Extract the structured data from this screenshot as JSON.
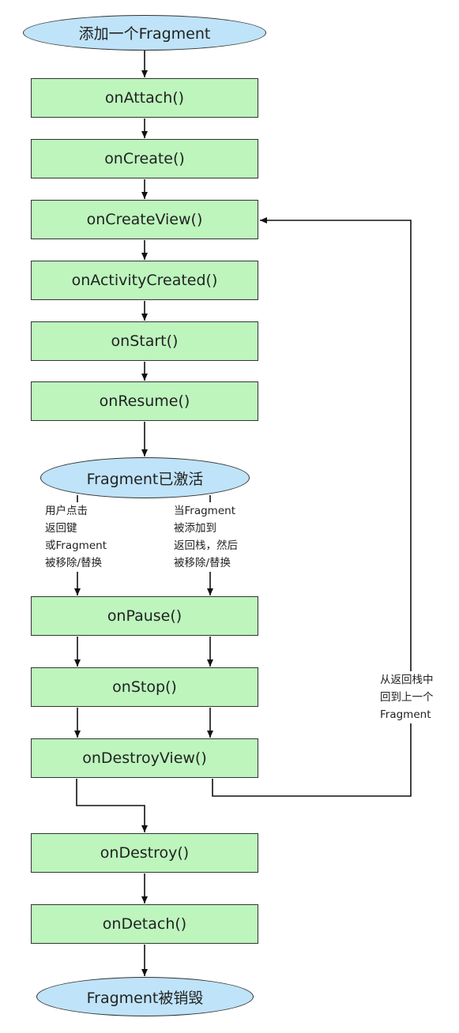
{
  "start": {
    "label": "添加一个Fragment"
  },
  "steps": [
    {
      "id": "on-attach",
      "label": "onAttach()"
    },
    {
      "id": "on-create",
      "label": "onCreate()"
    },
    {
      "id": "on-create-view",
      "label": "onCreateView()"
    },
    {
      "id": "on-activity-created",
      "label": "onActivityCreated()"
    },
    {
      "id": "on-start",
      "label": "onStart()"
    },
    {
      "id": "on-resume",
      "label": "onResume()"
    }
  ],
  "active": {
    "label": "Fragment已激活"
  },
  "branch_left": {
    "lines": [
      "用户点击",
      "返回键",
      "或Fragment",
      "被移除/替换"
    ]
  },
  "branch_right": {
    "lines": [
      "当Fragment",
      "被添加到",
      "返回栈，然后",
      "被移除/替换"
    ]
  },
  "teardown": [
    {
      "id": "on-pause",
      "label": "onPause()"
    },
    {
      "id": "on-stop",
      "label": "onStop()"
    },
    {
      "id": "on-destroy-view",
      "label": "onDestroyView()"
    },
    {
      "id": "on-destroy",
      "label": "onDestroy()"
    },
    {
      "id": "on-detach",
      "label": "onDetach()"
    }
  ],
  "back_stack_note": {
    "lines": [
      "从返回栈中",
      "回到上一个",
      "Fragment"
    ]
  },
  "end": {
    "label": "Fragment被销毁"
  },
  "colors": {
    "box_fill": "#bdf5bd",
    "ellipse_fill": "#bfe3f8",
    "stroke": "#333333",
    "text": "#222222"
  }
}
